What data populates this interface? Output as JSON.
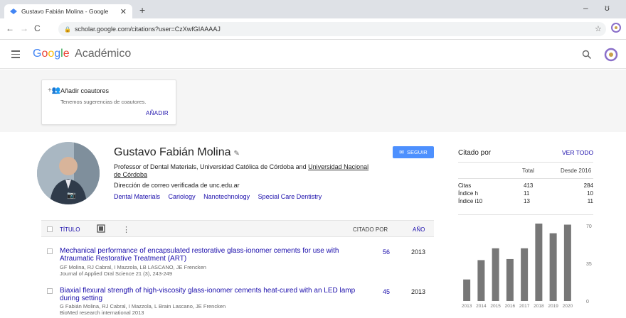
{
  "browser": {
    "tab_title": "Gustavo Fabián Molina - Google",
    "tab_close": "✕",
    "new_tab": "+",
    "url": "scholar.google.com/citations?user=CzXwfGIAAAAJ",
    "win_minimize": "–",
    "win_restore": "ʊ"
  },
  "header": {
    "logo_g": "G",
    "logo_o1": "o",
    "logo_o2": "o",
    "logo_g2": "g",
    "logo_l": "l",
    "logo_e": "e",
    "logo_suffix": "Académico"
  },
  "coauthors": {
    "title": "Añadir coautores",
    "subtitle": "Tenemos sugerencias de coautores.",
    "add_label": "AÑADIR"
  },
  "profile": {
    "name": "Gustavo Fabián Molina",
    "affiliation_prefix": "Professor of Dental Materials, Universidad Católica de Córdoba and ",
    "affiliation_link": "Universidad Nacional de Córdoba",
    "email": "Dirección de correo verificada de unc.edu.ar",
    "interests": [
      "Dental Materials",
      "Cariology",
      "Nanotechnology",
      "Special Care Dentistry"
    ],
    "follow_label": "SEGUIR"
  },
  "table": {
    "col_title": "TÍTULO",
    "col_cited": "CITADO POR",
    "col_year": "AÑO",
    "more": "⋮",
    "rows": [
      {
        "title": "Mechanical performance of encapsulated restorative glass-ionomer cements for use with Atraumatic Restorative Treatment (ART)",
        "authors": "GF Molina, RJ Cabral, I Mazzola, LB LASCANO, JE Frencken",
        "journal": "Journal of Applied Oral Science 21 (3), 243-249",
        "cited": "56",
        "year": "2013"
      },
      {
        "title": "Biaxial flexural strength of high-viscosity glass-ionomer cements heat-cured with an LED lamp during setting",
        "authors": "G Fabián Molina, RJ Cabral, I Mazzola, L Brain Lascano, JE Frencken",
        "journal": "BioMed research international 2013",
        "cited": "45",
        "year": "2013"
      }
    ]
  },
  "cited_by": {
    "title": "Citado por",
    "view_all": "VER TODO",
    "col_total": "Total",
    "col_since": "Desde 2016",
    "rows": [
      {
        "label": "Citas",
        "total": "413",
        "since": "284"
      },
      {
        "label": "Índice h",
        "total": "11",
        "since": "10"
      },
      {
        "label": "Índice i10",
        "total": "13",
        "since": "11"
      }
    ]
  },
  "chart_data": {
    "type": "bar",
    "categories": [
      "2013",
      "2014",
      "2015",
      "2016",
      "2017",
      "2018",
      "2019",
      "2020"
    ],
    "values": [
      20,
      38,
      49,
      39,
      49,
      72,
      63,
      71
    ],
    "yticks": [
      "70",
      "35",
      "0"
    ],
    "ylim": [
      0,
      70
    ]
  }
}
